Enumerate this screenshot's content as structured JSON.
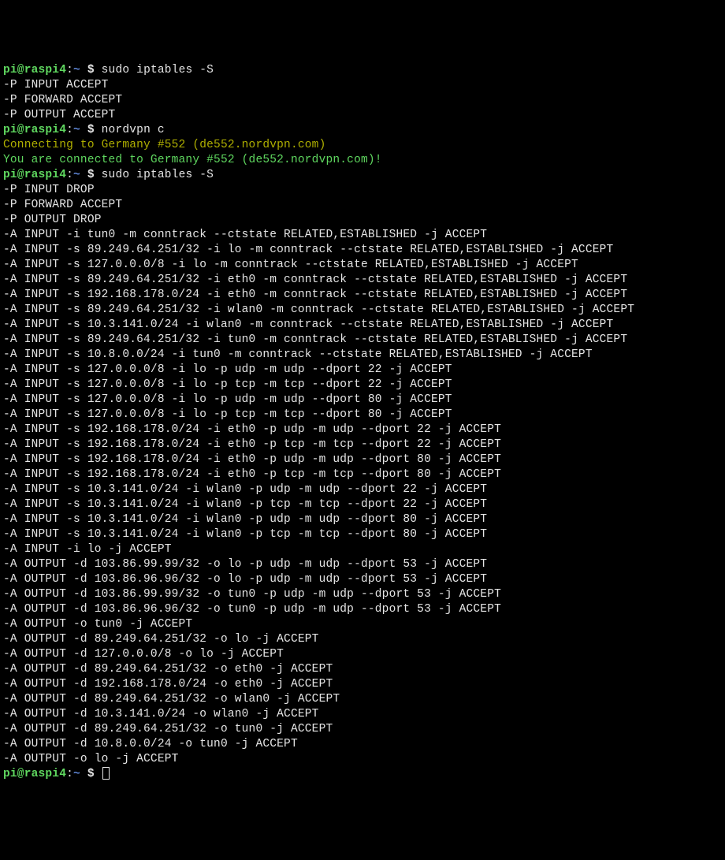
{
  "prompt": {
    "user_host": "pi@raspi4",
    "sep": ":",
    "tilde": "~",
    "dollar": " $"
  },
  "lines": [
    {
      "type": "prompt",
      "cmd": "sudo iptables -S"
    },
    {
      "type": "output",
      "text": "-P INPUT ACCEPT"
    },
    {
      "type": "output",
      "text": "-P FORWARD ACCEPT"
    },
    {
      "type": "output",
      "text": "-P OUTPUT ACCEPT"
    },
    {
      "type": "prompt",
      "cmd": "nordvpn c"
    },
    {
      "type": "yellow",
      "text": "Connecting to Germany #552 (de552.nordvpn.com)"
    },
    {
      "type": "green",
      "text": "You are connected to Germany #552 (de552.nordvpn.com)!"
    },
    {
      "type": "prompt",
      "cmd": "sudo iptables -S"
    },
    {
      "type": "output",
      "text": "-P INPUT DROP"
    },
    {
      "type": "output",
      "text": "-P FORWARD ACCEPT"
    },
    {
      "type": "output",
      "text": "-P OUTPUT DROP"
    },
    {
      "type": "output",
      "text": "-A INPUT -i tun0 -m conntrack --ctstate RELATED,ESTABLISHED -j ACCEPT"
    },
    {
      "type": "output",
      "text": "-A INPUT -s 89.249.64.251/32 -i lo -m conntrack --ctstate RELATED,ESTABLISHED -j ACCEPT"
    },
    {
      "type": "output",
      "text": "-A INPUT -s 127.0.0.0/8 -i lo -m conntrack --ctstate RELATED,ESTABLISHED -j ACCEPT"
    },
    {
      "type": "output",
      "text": "-A INPUT -s 89.249.64.251/32 -i eth0 -m conntrack --ctstate RELATED,ESTABLISHED -j ACCEPT"
    },
    {
      "type": "output",
      "text": "-A INPUT -s 192.168.178.0/24 -i eth0 -m conntrack --ctstate RELATED,ESTABLISHED -j ACCEPT"
    },
    {
      "type": "output",
      "text": "-A INPUT -s 89.249.64.251/32 -i wlan0 -m conntrack --ctstate RELATED,ESTABLISHED -j ACCEPT"
    },
    {
      "type": "output",
      "text": "-A INPUT -s 10.3.141.0/24 -i wlan0 -m conntrack --ctstate RELATED,ESTABLISHED -j ACCEPT"
    },
    {
      "type": "output",
      "text": "-A INPUT -s 89.249.64.251/32 -i tun0 -m conntrack --ctstate RELATED,ESTABLISHED -j ACCEPT"
    },
    {
      "type": "output",
      "text": "-A INPUT -s 10.8.0.0/24 -i tun0 -m conntrack --ctstate RELATED,ESTABLISHED -j ACCEPT"
    },
    {
      "type": "output",
      "text": "-A INPUT -s 127.0.0.0/8 -i lo -p udp -m udp --dport 22 -j ACCEPT"
    },
    {
      "type": "output",
      "text": "-A INPUT -s 127.0.0.0/8 -i lo -p tcp -m tcp --dport 22 -j ACCEPT"
    },
    {
      "type": "output",
      "text": "-A INPUT -s 127.0.0.0/8 -i lo -p udp -m udp --dport 80 -j ACCEPT"
    },
    {
      "type": "output",
      "text": "-A INPUT -s 127.0.0.0/8 -i lo -p tcp -m tcp --dport 80 -j ACCEPT"
    },
    {
      "type": "output",
      "text": "-A INPUT -s 192.168.178.0/24 -i eth0 -p udp -m udp --dport 22 -j ACCEPT"
    },
    {
      "type": "output",
      "text": "-A INPUT -s 192.168.178.0/24 -i eth0 -p tcp -m tcp --dport 22 -j ACCEPT"
    },
    {
      "type": "output",
      "text": "-A INPUT -s 192.168.178.0/24 -i eth0 -p udp -m udp --dport 80 -j ACCEPT"
    },
    {
      "type": "output",
      "text": "-A INPUT -s 192.168.178.0/24 -i eth0 -p tcp -m tcp --dport 80 -j ACCEPT"
    },
    {
      "type": "output",
      "text": "-A INPUT -s 10.3.141.0/24 -i wlan0 -p udp -m udp --dport 22 -j ACCEPT"
    },
    {
      "type": "output",
      "text": "-A INPUT -s 10.3.141.0/24 -i wlan0 -p tcp -m tcp --dport 22 -j ACCEPT"
    },
    {
      "type": "output",
      "text": "-A INPUT -s 10.3.141.0/24 -i wlan0 -p udp -m udp --dport 80 -j ACCEPT"
    },
    {
      "type": "output",
      "text": "-A INPUT -s 10.3.141.0/24 -i wlan0 -p tcp -m tcp --dport 80 -j ACCEPT"
    },
    {
      "type": "output",
      "text": "-A INPUT -i lo -j ACCEPT"
    },
    {
      "type": "output",
      "text": "-A OUTPUT -d 103.86.99.99/32 -o lo -p udp -m udp --dport 53 -j ACCEPT"
    },
    {
      "type": "output",
      "text": "-A OUTPUT -d 103.86.96.96/32 -o lo -p udp -m udp --dport 53 -j ACCEPT"
    },
    {
      "type": "output",
      "text": "-A OUTPUT -d 103.86.99.99/32 -o tun0 -p udp -m udp --dport 53 -j ACCEPT"
    },
    {
      "type": "output",
      "text": "-A OUTPUT -d 103.86.96.96/32 -o tun0 -p udp -m udp --dport 53 -j ACCEPT"
    },
    {
      "type": "output",
      "text": "-A OUTPUT -o tun0 -j ACCEPT"
    },
    {
      "type": "output",
      "text": "-A OUTPUT -d 89.249.64.251/32 -o lo -j ACCEPT"
    },
    {
      "type": "output",
      "text": "-A OUTPUT -d 127.0.0.0/8 -o lo -j ACCEPT"
    },
    {
      "type": "output",
      "text": "-A OUTPUT -d 89.249.64.251/32 -o eth0 -j ACCEPT"
    },
    {
      "type": "output",
      "text": "-A OUTPUT -d 192.168.178.0/24 -o eth0 -j ACCEPT"
    },
    {
      "type": "output",
      "text": "-A OUTPUT -d 89.249.64.251/32 -o wlan0 -j ACCEPT"
    },
    {
      "type": "output",
      "text": "-A OUTPUT -d 10.3.141.0/24 -o wlan0 -j ACCEPT"
    },
    {
      "type": "output",
      "text": "-A OUTPUT -d 89.249.64.251/32 -o tun0 -j ACCEPT"
    },
    {
      "type": "output",
      "text": "-A OUTPUT -d 10.8.0.0/24 -o tun0 -j ACCEPT"
    },
    {
      "type": "output",
      "text": "-A OUTPUT -o lo -j ACCEPT"
    },
    {
      "type": "prompt-cursor",
      "cmd": ""
    }
  ]
}
